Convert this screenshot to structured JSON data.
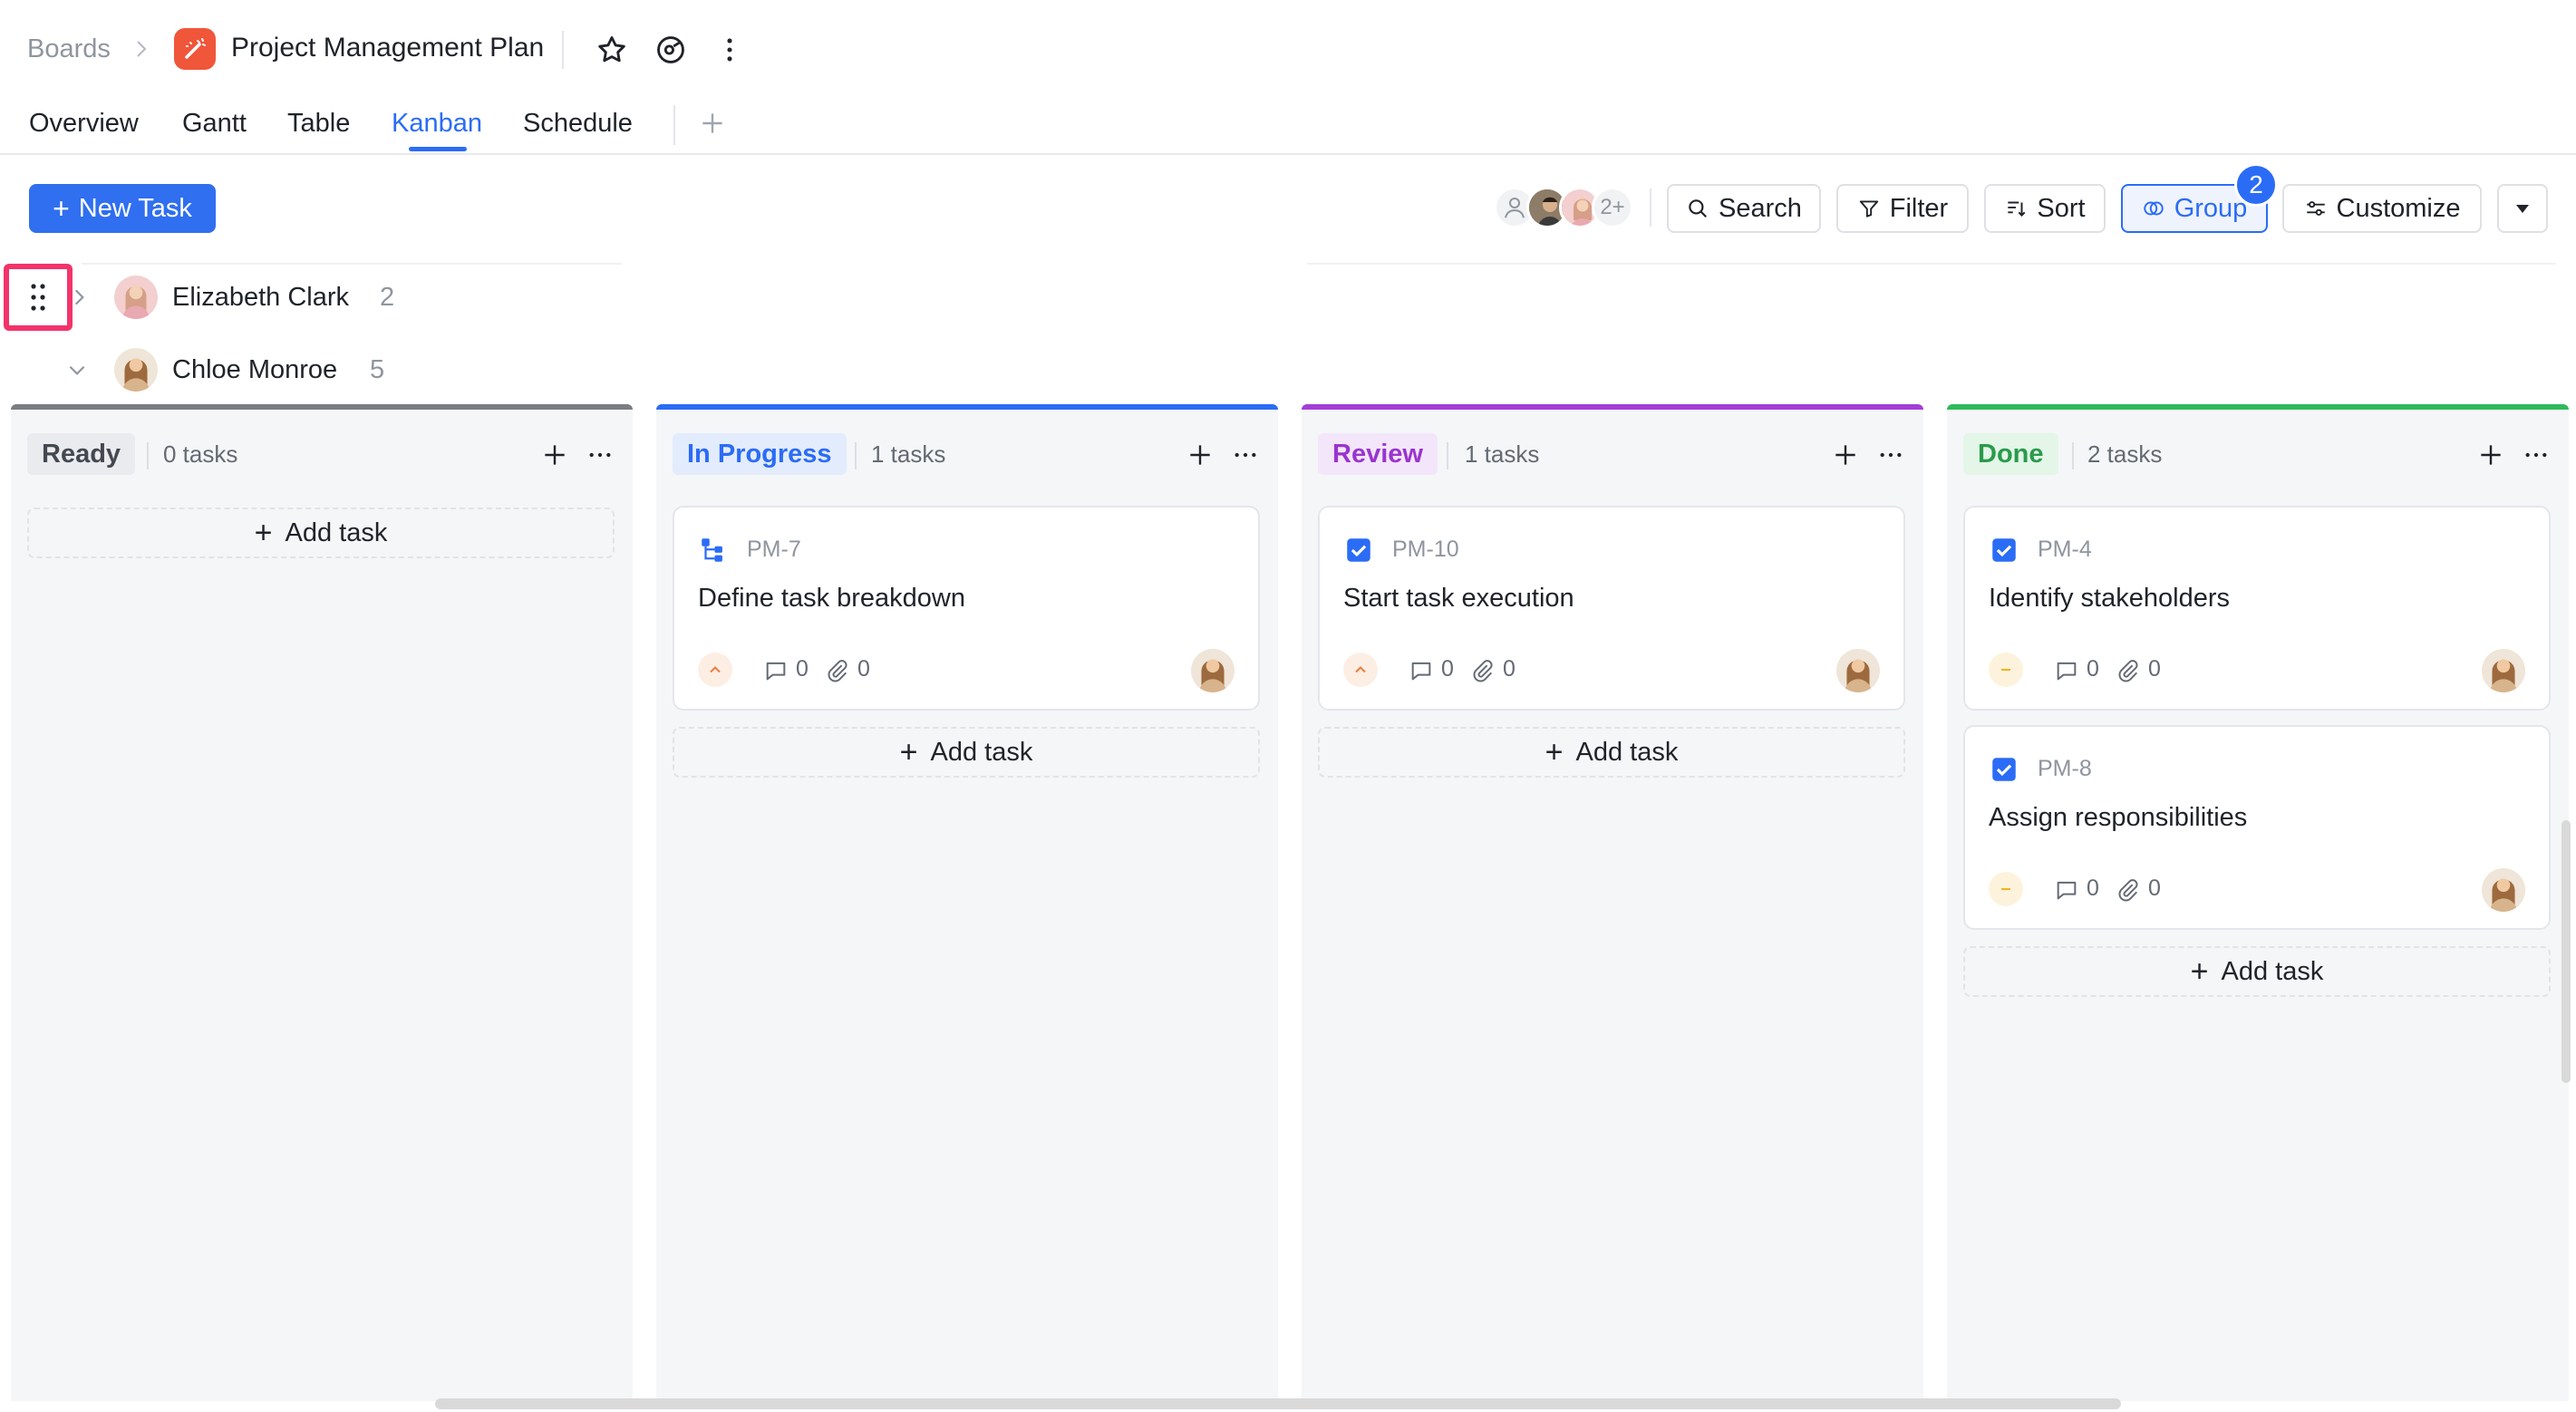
{
  "header": {
    "breadcrumb_root": "Boards",
    "title": "Project Management Plan"
  },
  "tabs": [
    {
      "label": "Overview"
    },
    {
      "label": "Gantt"
    },
    {
      "label": "Table"
    },
    {
      "label": "Kanban",
      "active": true
    },
    {
      "label": "Schedule"
    }
  ],
  "toolbar": {
    "new_task_label": "New Task",
    "members_more": "2+",
    "search_label": "Search",
    "filter_label": "Filter",
    "sort_label": "Sort",
    "group_label": "Group",
    "group_badge": "2",
    "customize_label": "Customize"
  },
  "groups": [
    {
      "name": "Elizabeth Clark",
      "count": "2",
      "expanded": false
    },
    {
      "name": "Chloe Monroe",
      "count": "5",
      "expanded": true
    }
  ],
  "columns": [
    {
      "name": "Ready",
      "count": "0 tasks",
      "accent": "#7a7d82",
      "chip_bg": "#eaebee",
      "chip_color": "#444850",
      "cards": [],
      "add_label": "Add task"
    },
    {
      "name": "In Progress",
      "count": "1 tasks",
      "accent": "#2b6cf6",
      "chip_bg": "#e3ecfd",
      "chip_color": "#2b6cf6",
      "add_label": "Add task",
      "cards": [
        {
          "id": "PM-7",
          "title": "Define task breakdown",
          "type_icon": "subtask-icon",
          "priority": "high",
          "comments": "0",
          "attachments": "0"
        }
      ]
    },
    {
      "name": "Review",
      "count": "1 tasks",
      "accent": "#a33ed8",
      "chip_bg": "#f3e6fb",
      "chip_color": "#9a34cf",
      "add_label": "Add task",
      "cards": [
        {
          "id": "PM-10",
          "title": "Start task execution",
          "type_icon": "checkbox-icon",
          "priority": "high",
          "comments": "0",
          "attachments": "0"
        }
      ]
    },
    {
      "name": "Done",
      "count": "2 tasks",
      "accent": "#2fba5a",
      "chip_bg": "#e3f6e8",
      "chip_color": "#2a9a4b",
      "add_label": "Add task",
      "cards": [
        {
          "id": "PM-4",
          "title": "Identify stakeholders",
          "type_icon": "checkbox-icon",
          "priority": "medium",
          "comments": "0",
          "attachments": "0"
        },
        {
          "id": "PM-8",
          "title": "Assign responsibilities",
          "type_icon": "checkbox-icon",
          "priority": "medium",
          "comments": "0",
          "attachments": "0"
        }
      ]
    }
  ],
  "colors": {
    "primary": "#2f6ff0",
    "highlight": "#f3336a",
    "priority_high": "#f07b3a",
    "priority_medium": "#f0b429"
  }
}
